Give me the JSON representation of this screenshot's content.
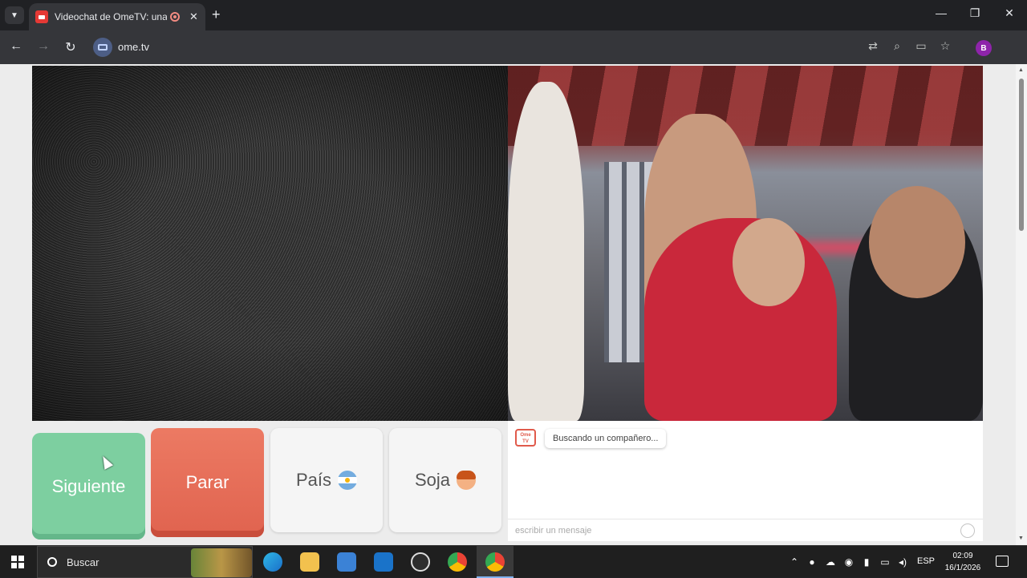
{
  "browser": {
    "tab": {
      "title": "Videochat de OmeTV: una a"
    },
    "url": "ome.tv",
    "profile_initial": "B"
  },
  "app": {
    "buttons": {
      "next": "Siguiente",
      "stop": "Parar",
      "country": "País",
      "gender": "Soja"
    },
    "chat": {
      "logo_text": "Ome TV",
      "status_message": "Buscando un compañero...",
      "input_placeholder": "escribir un mensaje"
    }
  },
  "taskbar": {
    "search_placeholder": "Buscar",
    "language": "ESP",
    "time": "02:09",
    "date": "16/1/2026"
  },
  "colors": {
    "next_button": "#7dcfa0",
    "stop_button": "#e5674f",
    "accent_record": "#f28b82"
  }
}
